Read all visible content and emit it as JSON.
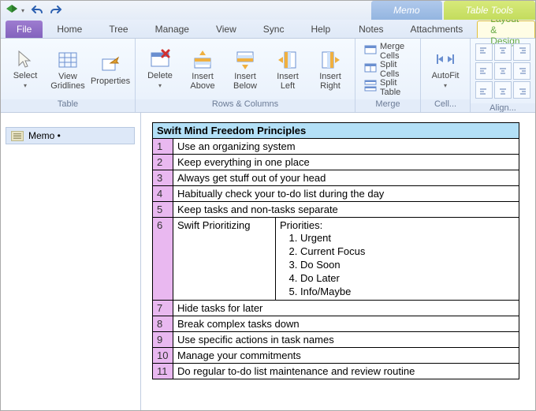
{
  "qat": {
    "undo_tip": "Undo",
    "redo_tip": "Redo"
  },
  "context": {
    "memo": "Memo",
    "table_tools": "Table Tools"
  },
  "tabs": {
    "file": "File",
    "home": "Home",
    "tree": "Tree",
    "manage": "Manage",
    "view": "View",
    "sync": "Sync",
    "help": "Help",
    "notes": "Notes",
    "attachments": "Attachments",
    "layout_design": "Layout & Design"
  },
  "ribbon": {
    "table_group": "Table",
    "select": "Select",
    "view_gridlines": "View Gridlines",
    "properties": "Properties",
    "rows_cols_group": "Rows & Columns",
    "delete": "Delete",
    "insert_above": "Insert Above",
    "insert_below": "Insert Below",
    "insert_left": "Insert Left",
    "insert_right": "Insert Right",
    "merge_group": "Merge",
    "merge_cells": "Merge Cells",
    "split_cells": "Split Cells",
    "split_table": "Split Table",
    "cell_group": "Cell...",
    "autofit": "AutoFit",
    "align_group": "Align..."
  },
  "sidebar": {
    "memo_item": "Memo •"
  },
  "doc": {
    "title": "Swift Mind Freedom Principles",
    "rows": [
      {
        "n": "1",
        "text": "Use an organizing system"
      },
      {
        "n": "2",
        "text": "Keep everything in one place"
      },
      {
        "n": "3",
        "text": "Always get stuff out of your head"
      },
      {
        "n": "4",
        "text": "Habitually check your to-do list during the day"
      },
      {
        "n": "5",
        "text": "Keep tasks and non-tasks separate"
      }
    ],
    "row6": {
      "n": "6",
      "left": "Swift Prioritizing",
      "right_header": "Priorities:",
      "priorities": [
        "Urgent",
        "Current Focus",
        "Do Soon",
        "Do Later",
        "Info/Maybe"
      ]
    },
    "rows2": [
      {
        "n": "7",
        "text": "Hide tasks for later"
      },
      {
        "n": "8",
        "text": "Break complex tasks down"
      },
      {
        "n": "9",
        "text": "Use specific actions in task names"
      },
      {
        "n": "10",
        "text": "Manage your commitments"
      },
      {
        "n": "11",
        "text": "Do regular to-do list maintenance and review routine"
      }
    ]
  }
}
